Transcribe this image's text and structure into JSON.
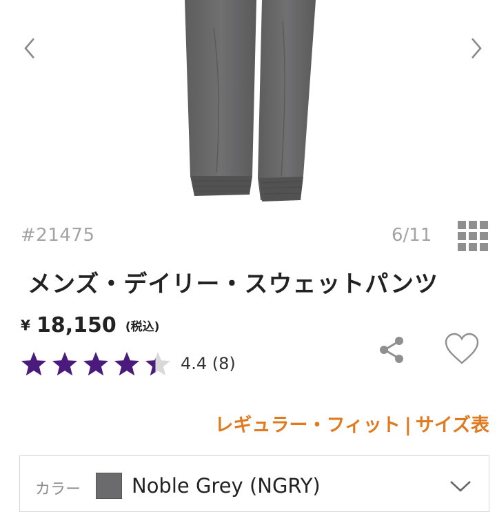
{
  "gallery": {
    "prev_icon": "chevron-left-icon",
    "next_icon": "chevron-right-icon",
    "image_alt": "product-image-grey-sweatpants"
  },
  "product": {
    "sku": "#21475",
    "image_counter": "6/11",
    "title": "メンズ・デイリー・スウェットパンツ",
    "currency_symbol": "¥",
    "price": "18,150",
    "tax_note": "(税込)",
    "rating_value": 4.4,
    "rating_text": "4.4 (8)",
    "star_color": "#4b1a7d",
    "star_empty_color": "#d9d9d9"
  },
  "actions": {
    "share_icon": "share-icon",
    "wishlist_icon": "heart-icon",
    "gallery_grid_icon": "grid-icon"
  },
  "fit": {
    "fit_label": "レギュラー・フィット",
    "separator": "|",
    "size_chart_label": "サイズ表",
    "accent_color": "#e07a1f"
  },
  "color_selector": {
    "label": "カラー",
    "selected_value": "Noble Grey (NGRY)",
    "swatch_color": "#6b6b6d",
    "dropdown_icon": "chevron-down-icon"
  }
}
